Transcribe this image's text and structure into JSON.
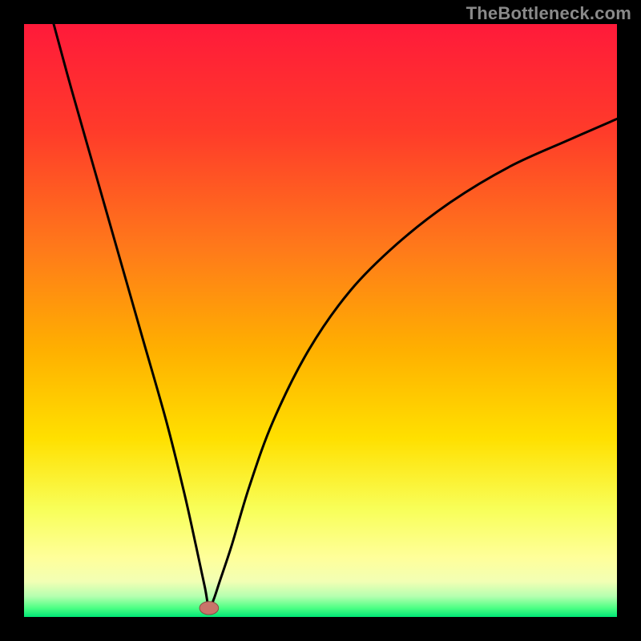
{
  "watermark": "TheBottleneck.com",
  "palette": {
    "bg": "#000000",
    "curve": "#000000",
    "marker_fill": "#c9746a",
    "marker_stroke": "#8a4a42",
    "gradient_stops": [
      {
        "offset": 0.0,
        "color": "#ff1a3a"
      },
      {
        "offset": 0.18,
        "color": "#ff3b2a"
      },
      {
        "offset": 0.38,
        "color": "#ff7a1a"
      },
      {
        "offset": 0.55,
        "color": "#ffb000"
      },
      {
        "offset": 0.7,
        "color": "#ffe000"
      },
      {
        "offset": 0.82,
        "color": "#f8ff5a"
      },
      {
        "offset": 0.9,
        "color": "#ffff9a"
      },
      {
        "offset": 0.94,
        "color": "#f2ffb4"
      },
      {
        "offset": 0.965,
        "color": "#b6ffb0"
      },
      {
        "offset": 0.985,
        "color": "#4cff84"
      },
      {
        "offset": 1.0,
        "color": "#00e676"
      }
    ]
  },
  "chart_data": {
    "type": "line",
    "title": "",
    "xlabel": "",
    "ylabel": "",
    "xlim": [
      0,
      100
    ],
    "ylim": [
      0,
      100
    ],
    "grid": false,
    "series": [
      {
        "name": "bottleneck_curve",
        "x": [
          5,
          8,
          12,
          16,
          20,
          24,
          27,
          29,
          30.5,
          31.2,
          32,
          33,
          35,
          38,
          42,
          48,
          55,
          63,
          72,
          82,
          92,
          100
        ],
        "y": [
          100,
          89,
          75,
          61,
          47,
          33,
          21,
          12,
          5,
          1.5,
          3,
          6,
          12,
          22,
          33,
          45,
          55,
          63,
          70,
          76,
          80.5,
          84
        ]
      }
    ],
    "marker": {
      "x": 31.2,
      "y": 1.5,
      "rx": 1.6,
      "ry": 1.1
    },
    "notes": "V-shaped bottleneck curve over red-to-green vertical gradient; minimum near x≈31 at y≈1.5."
  }
}
